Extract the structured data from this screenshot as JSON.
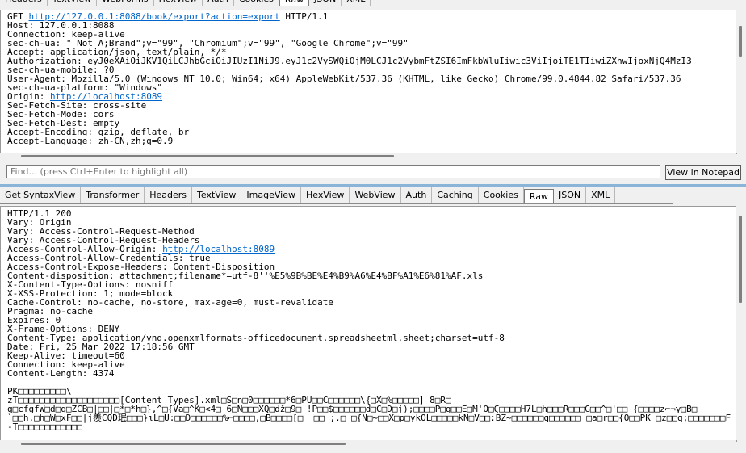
{
  "request_tabs": [
    "Headers",
    "TextView",
    "WebForms",
    "HexView",
    "Auth",
    "Cookies",
    "Raw",
    "JSON",
    "XML"
  ],
  "request_active_tab": "Raw",
  "request": {
    "line_method": "GET ",
    "line_url": "http://127.0.0.1:8088/book/export?action=export",
    "line_proto": " HTTP/1.1",
    "lines_a": [
      "Host: 127.0.0.1:8088",
      "Connection: keep-alive",
      "sec-ch-ua: \" Not A;Brand\";v=\"99\", \"Chromium\";v=\"99\", \"Google Chrome\";v=\"99\"",
      "Accept: application/json, text/plain, */*",
      "Authorization: eyJ0eXAiOiJKV1QiLCJhbGciOiJIUzI1NiJ9.eyJ1c2VySWQiOjM0LCJ1c2VybmFtZSI6ImFkbWluIiwic3ViIjoiTE1TIiwiZXhwIjoxNjQ4MzI3",
      "sec-ch-ua-mobile: ?0",
      "User-Agent: Mozilla/5.0 (Windows NT 10.0; Win64; x64) AppleWebKit/537.36 (KHTML, like Gecko) Chrome/99.0.4844.82 Safari/537.36",
      "sec-ch-ua-platform: \"Windows\""
    ],
    "origin_label": "Origin: ",
    "origin_url": "http://localhost:8089",
    "lines_b": [
      "Sec-Fetch-Site: cross-site",
      "Sec-Fetch-Mode: cors",
      "Sec-Fetch-Dest: empty",
      "Accept-Encoding: gzip, deflate, br",
      "Accept-Language: zh-CN,zh;q=0.9"
    ]
  },
  "find": {
    "placeholder": "Find... (press Ctrl+Enter to highlight all)",
    "button_label": "View in Notepad"
  },
  "response_tabs": [
    "Get SyntaxView",
    "Transformer",
    "Headers",
    "TextView",
    "ImageView",
    "HexView",
    "WebView",
    "Auth",
    "Caching",
    "Cookies",
    "Raw",
    "JSON",
    "XML"
  ],
  "response_active_tab": "Raw",
  "response": {
    "lines_a": [
      "HTTP/1.1 200",
      "Vary: Origin",
      "Vary: Access-Control-Request-Method",
      "Vary: Access-Control-Request-Headers"
    ],
    "acao_label": "Access-Control-Allow-Origin: ",
    "acao_url": "http://localhost:8089",
    "lines_b": [
      "Access-Control-Allow-Credentials: true",
      "Access-Control-Expose-Headers: Content-Disposition",
      "Content-disposition: attachment;filename*=utf-8''%E5%9B%BE%E4%B9%A6%E4%BF%A1%E6%81%AF.xls",
      "X-Content-Type-Options: nosniff",
      "X-XSS-Protection: 1; mode=block",
      "Cache-Control: no-cache, no-store, max-age=0, must-revalidate",
      "Pragma: no-cache",
      "Expires: 0",
      "X-Frame-Options: DENY",
      "Content-Type: application/vnd.openxmlformats-officedocument.spreadsheetml.sheet;charset=utf-8",
      "Date: Fri, 25 Mar 2022 17:18:56 GMT",
      "Keep-Alive: timeout=60",
      "Connection: keep-alive",
      "Content-Length: 4374"
    ],
    "body_lines": [
      "PK□□□□□□□□□\\",
      "zT□□□□□□□□□□□□□□□□□□□[Content_Types].xml□S□n□0□□□□□□*6□PU□□C□□□□□□\\{□X□%□□□□□] 8□R□",
      "q□cfgfW□d□q□ZCB□|□□|□*□*h□},^□{Va□^K□<4□ 6□N□□□XQ□dž□9□ !P□□$□□□□□□d□C□D□j);□□□□P□g□□E□M'O□Ϛ□□□□H7L□h□□□R□□□G□□^□'□□ {□□□□z⌐¬γ□B□",
      "`□□h.□h□W□xF□□|j羨CQD珉□□□}ιL□U:□□D□□□□□□%⌐□□□□,□B□□□□[□  □□ ;.□ □{N□~□□X□p□ykOL□□□□□kN□V□□:BZ~□□□□□□q□□□□□□ □a□r□□{O□□PK □z□□q;□□□□□□□F",
      "-T□□□□□□□□□□□□"
    ]
  }
}
